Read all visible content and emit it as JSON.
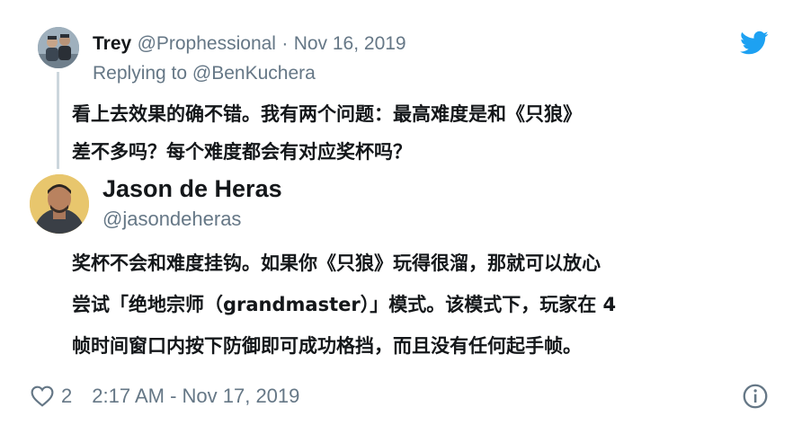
{
  "parent_tweet": {
    "author_name": "Trey",
    "author_handle": "@Prophessional",
    "separator": "·",
    "date": "Nov 16, 2019",
    "replying_prefix": "Replying to",
    "replying_to": "@BenKuchera",
    "text_line1": "看上去效果的确不错。我有两个问题：最高难度是和《只狼》",
    "text_line2": "差不多吗？每个难度都会有对应奖杯吗？"
  },
  "main_tweet": {
    "author_name": "Jason de Heras",
    "author_handle": "@jasondeheras",
    "text_line1": "奖杯不会和难度挂钩。如果你《只狼》玩得很溜，那就可以放心",
    "text_line2": "尝试「绝地宗师（grandmaster）」模式。该模式下，玩家在 4",
    "text_line3": "帧时间窗口内按下防御即可成功格挡，而且没有任何起手帧。",
    "likes": "2",
    "timestamp": "2:17 AM - Nov 17, 2019"
  },
  "colors": {
    "twitter_blue": "#1da1f2",
    "secondary_text": "#657786",
    "primary_text": "#14171a",
    "thread_line": "#ccd6dd"
  },
  "icons": {
    "brand": "twitter-bird-icon",
    "like": "heart-icon",
    "info": "info-icon"
  }
}
